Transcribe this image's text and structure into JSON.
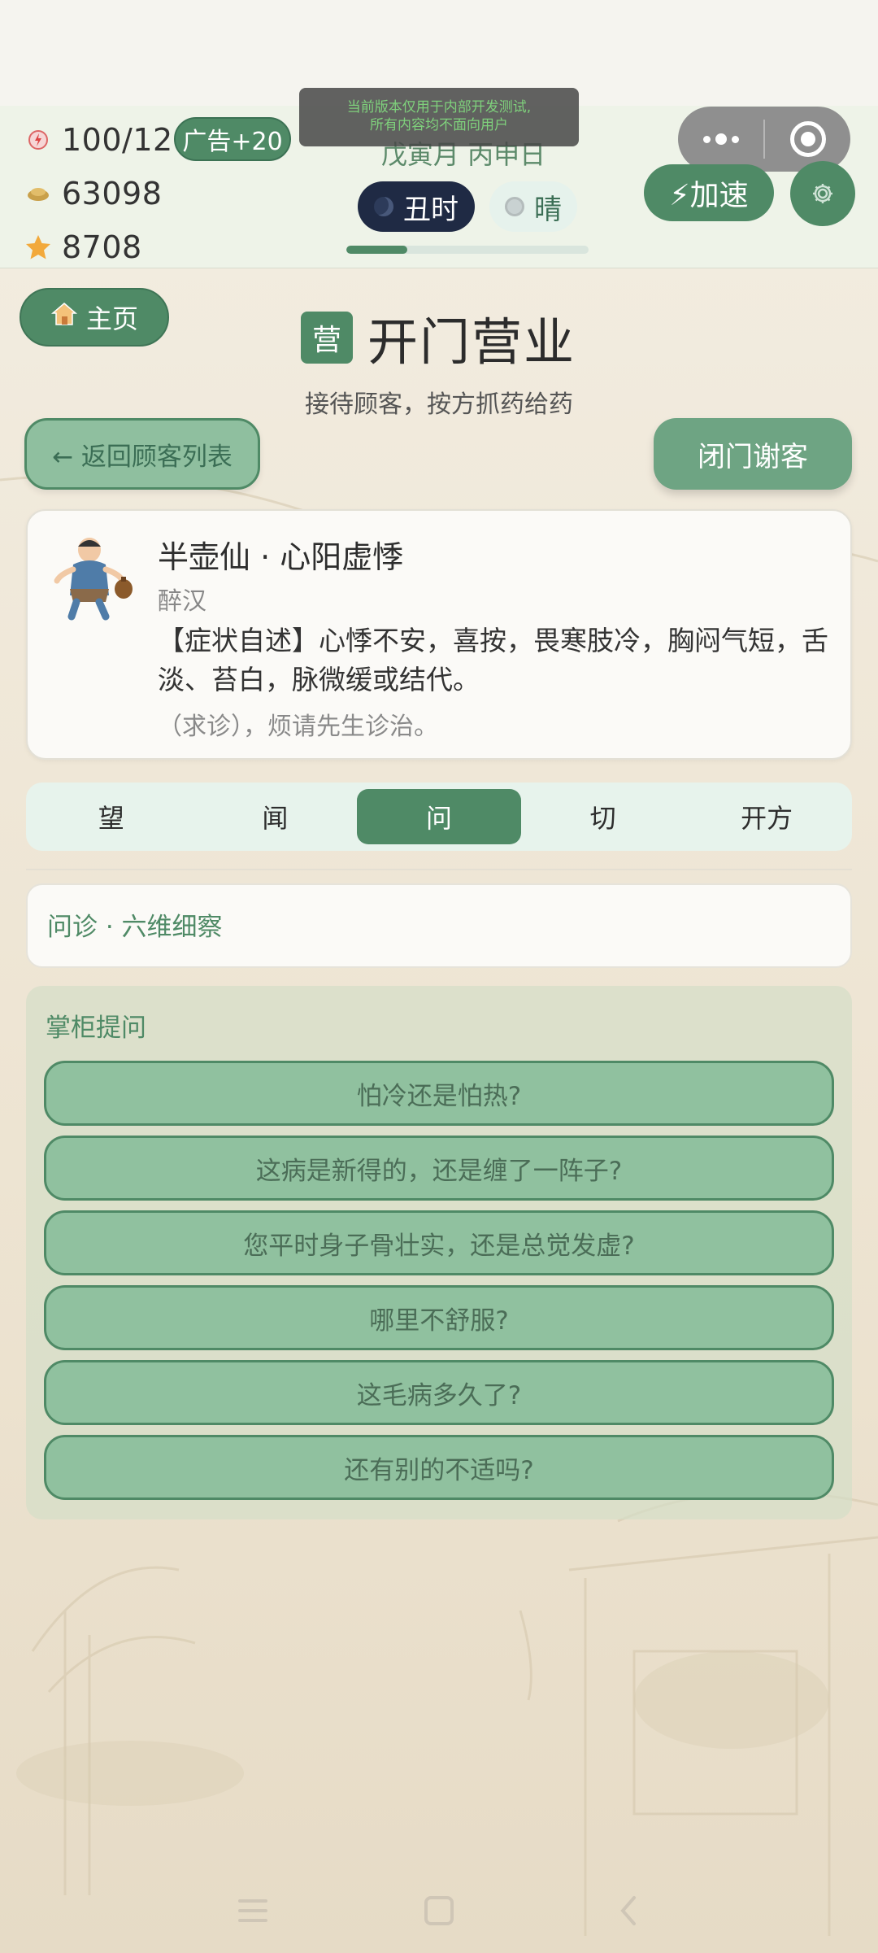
{
  "status": {
    "energy": "100/120",
    "coins": "63098",
    "stars": "8708",
    "ad_button": "广告+20",
    "dev_notice_line1": "当前版本仅用于内部开发测试,",
    "dev_notice_line2": "所有内容均不面向用户",
    "date": "戊寅月 丙申日",
    "hour": "丑时",
    "weather": "晴",
    "day_progress": 0.25,
    "speed_button": "⚡加速"
  },
  "header": {
    "home_button": "主页",
    "title_badge": "营",
    "title": "开门营业",
    "subtitle": "接待顾客，按方抓药给药",
    "back_button": "← 返回顾客列表",
    "close_button": "闭门谢客"
  },
  "customer": {
    "name": "半壶仙 · 心阳虚悸",
    "role": "醉汉",
    "symptom": "【症状自述】心悸不安，喜按，畏寒肢冷，胸闷气短，舌淡、苔白，脉微缓或结代。",
    "request": "（求诊），烦请先生诊治。"
  },
  "tabs": [
    {
      "label": "望"
    },
    {
      "label": "闻"
    },
    {
      "label": "问"
    },
    {
      "label": "切"
    },
    {
      "label": "开方"
    }
  ],
  "active_tab": "问",
  "inquiry": {
    "title": "问诊 · 六维细察"
  },
  "questions": {
    "label": "掌柜提问",
    "items": [
      "怕冷还是怕热?",
      "这病是新得的，还是缠了一阵子?",
      "您平时身子骨壮实，还是总觉发虚?",
      "哪里不舒服?",
      "这毛病多久了?",
      "还有别的不适吗?"
    ]
  },
  "colors": {
    "primary_green": "#4f8a66",
    "light_green": "#90c19f",
    "night_pill": "#1f2a44"
  }
}
